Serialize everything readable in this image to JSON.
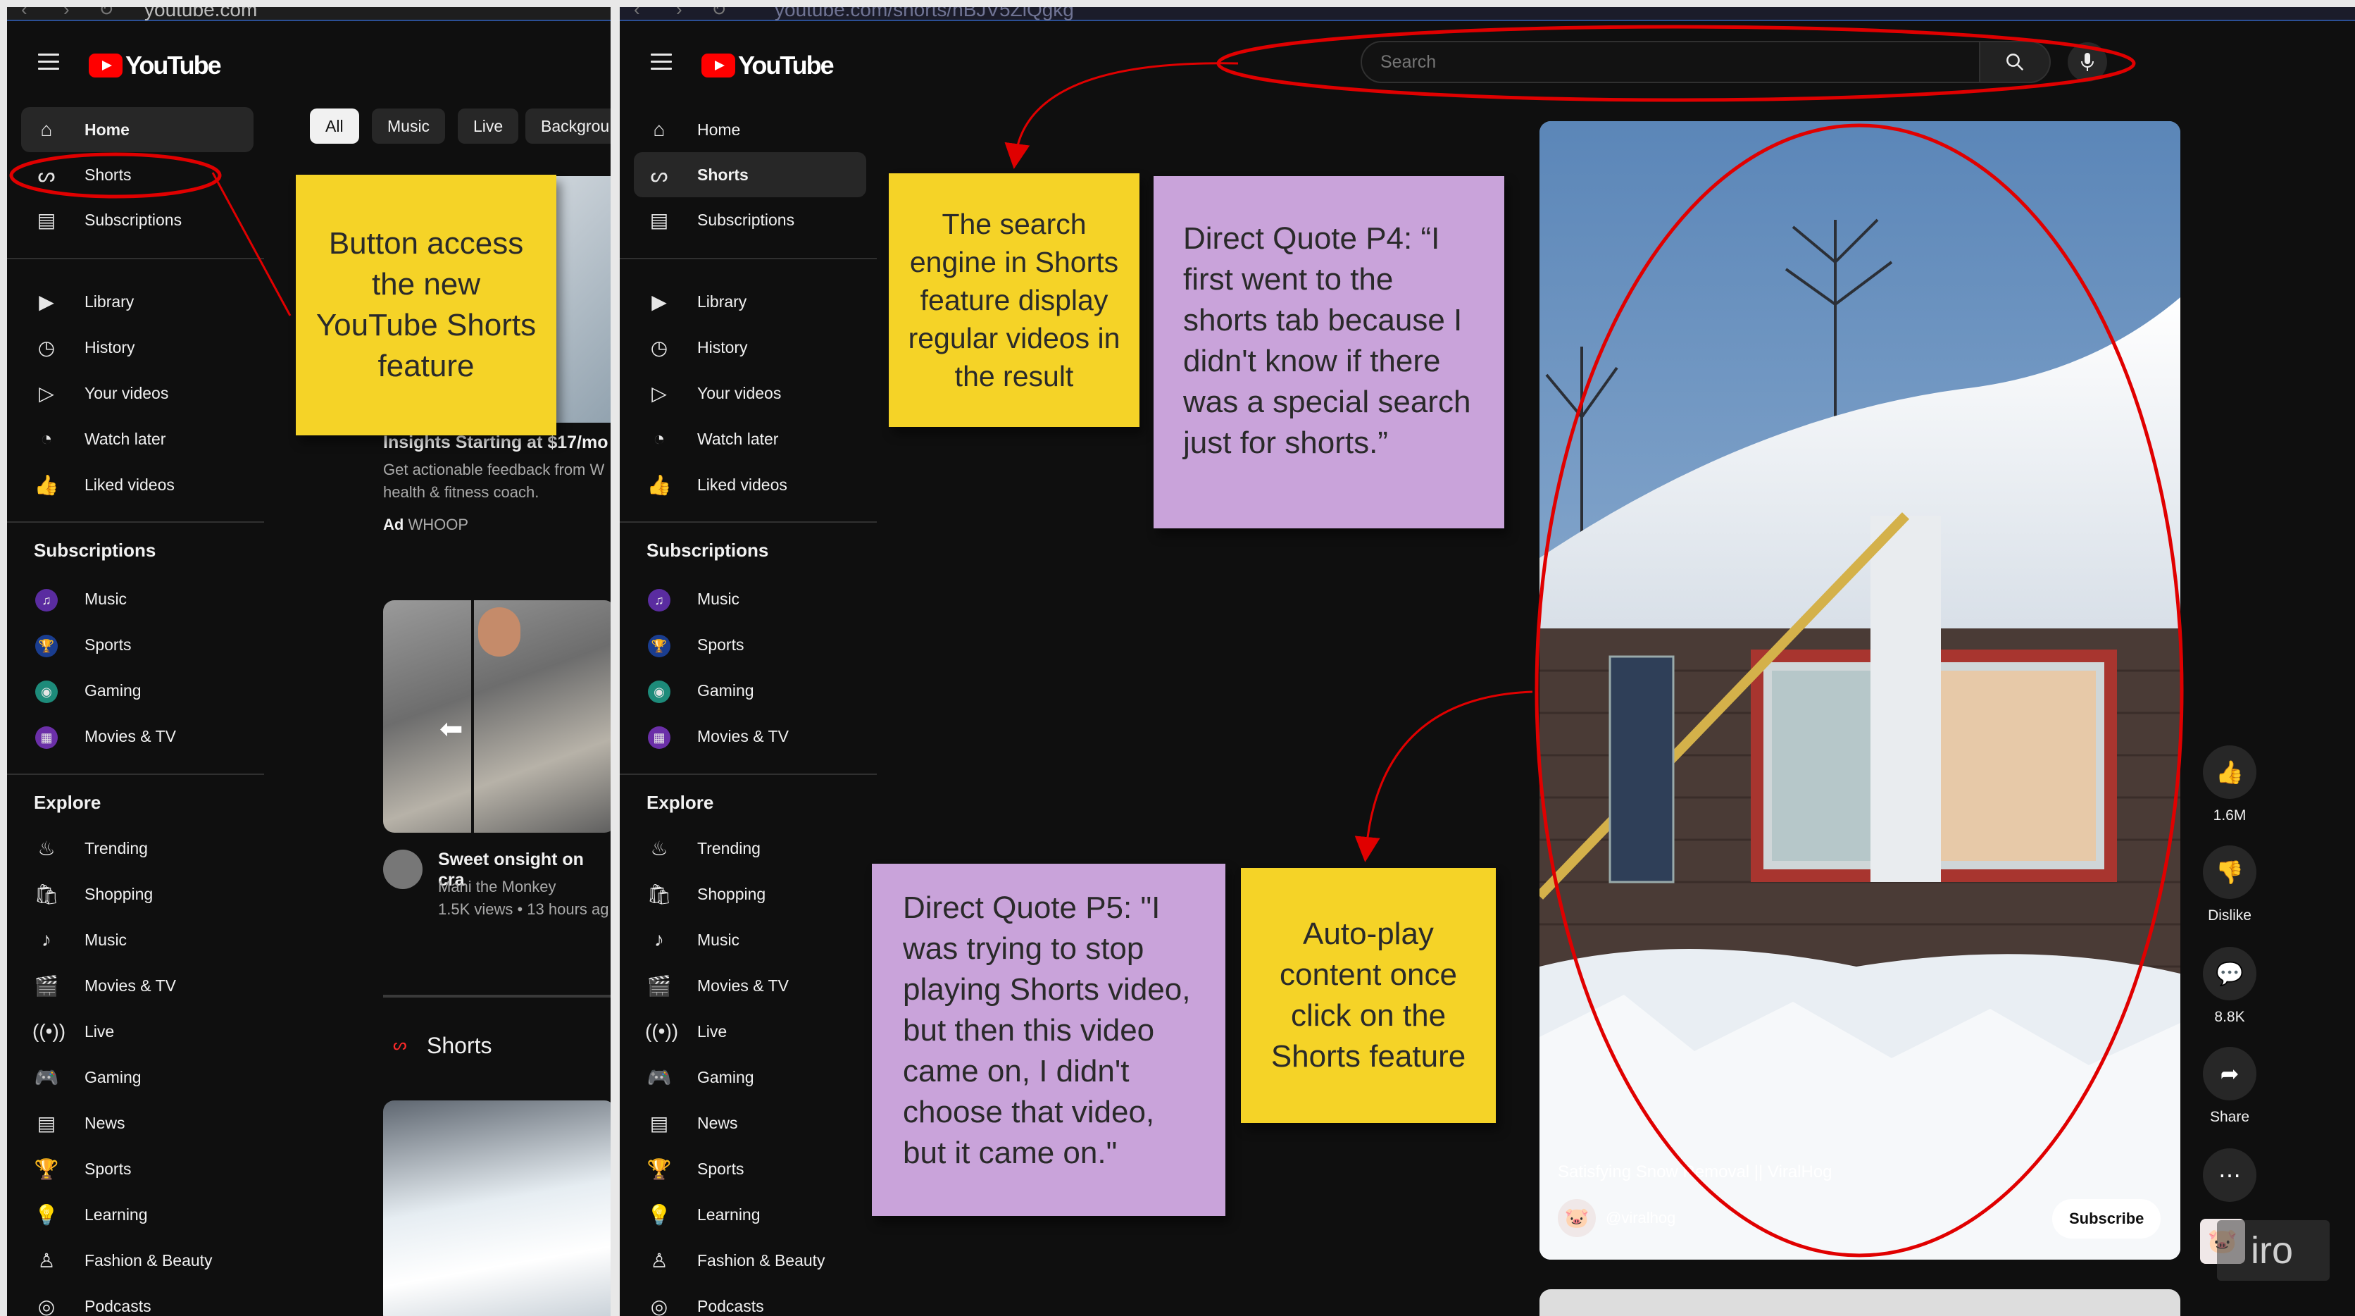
{
  "left_screen": {
    "url": "youtube.com",
    "brand": "YouTube",
    "nav_main": [
      {
        "label": "Home",
        "icon": "home-icon"
      },
      {
        "label": "Shorts",
        "icon": "shorts-icon"
      },
      {
        "label": "Subscriptions",
        "icon": "subscriptions-icon"
      }
    ],
    "nav_library": [
      {
        "label": "Library",
        "icon": "library-icon"
      },
      {
        "label": "History",
        "icon": "history-icon"
      },
      {
        "label": "Your videos",
        "icon": "your-videos-icon"
      },
      {
        "label": "Watch later",
        "icon": "watch-later-icon"
      },
      {
        "label": "Liked videos",
        "icon": "liked-icon"
      }
    ],
    "subscriptions_title": "Subscriptions",
    "subscriptions": [
      "Music",
      "Sports",
      "Gaming",
      "Movies & TV"
    ],
    "explore_title": "Explore",
    "explore": [
      "Trending",
      "Shopping",
      "Music",
      "Movies & TV",
      "Live",
      "Gaming",
      "News",
      "Sports",
      "Learning",
      "Fashion & Beauty",
      "Podcasts"
    ],
    "chips": [
      "All",
      "Music",
      "Live",
      "Backgrou"
    ],
    "ad": {
      "title": "Insights Starting at $17/mo",
      "desc_line1": "Get actionable feedback from W",
      "desc_line2": "health & fitness coach.",
      "badge": "Ad",
      "sponsor": "WHOOP"
    },
    "video": {
      "title": "Sweet onsight on cra",
      "channel": "Mani the Monkey",
      "meta": "1.5K views • 13 hours ag"
    },
    "shorts_heading": "Shorts",
    "sticky_note": "Button access the new YouTube Shorts feature"
  },
  "right_screen": {
    "url": "youtube.com/shorts/nBJV5ZlQgkg",
    "brand": "YouTube",
    "search_placeholder": "Search",
    "nav_main": [
      {
        "label": "Home",
        "icon": "home-icon"
      },
      {
        "label": "Shorts",
        "icon": "shorts-icon"
      },
      {
        "label": "Subscriptions",
        "icon": "subscriptions-icon"
      }
    ],
    "nav_library": [
      {
        "label": "Library",
        "icon": "library-icon"
      },
      {
        "label": "History",
        "icon": "history-icon"
      },
      {
        "label": "Your videos",
        "icon": "your-videos-icon"
      },
      {
        "label": "Watch later",
        "icon": "watch-later-icon"
      },
      {
        "label": "Liked videos",
        "icon": "liked-icon"
      }
    ],
    "subscriptions_title": "Subscriptions",
    "subscriptions": [
      "Music",
      "Sports",
      "Gaming",
      "Movies & TV"
    ],
    "explore_title": "Explore",
    "explore": [
      "Trending",
      "Shopping",
      "Music",
      "Movies & TV",
      "Live",
      "Gaming",
      "News",
      "Sports",
      "Learning",
      "Fashion & Beauty",
      "Podcasts"
    ],
    "short": {
      "title": "Satisfying Snow Removal || ViralHog",
      "channel": "@viralhog",
      "subscribe": "Subscribe"
    },
    "actions": [
      {
        "icon": "like-icon",
        "label": "1.6M"
      },
      {
        "icon": "dislike-icon",
        "label": "Dislike"
      },
      {
        "icon": "comment-icon",
        "label": "8.8K"
      },
      {
        "icon": "share-icon",
        "label": "Share"
      },
      {
        "icon": "more-icon",
        "label": ""
      }
    ],
    "sticky_search": "The search engine in Shorts feature display regular videos in the result",
    "quote_p4": "Direct Quote P4: “I first went to the shorts tab because I didn't know if there was a special search just for shorts.”",
    "quote_p5": "Direct Quote P5: \"I was trying to stop playing Shorts video, but then this video came on, I didn't choose that video, but it came on.\"",
    "sticky_autoplay": "Auto-play content once click on the Shorts feature",
    "watermark": "iro"
  },
  "annotation_color": "#e00000",
  "sticky_yellow": "#f5d327",
  "sticky_purple": "#c9a3da"
}
